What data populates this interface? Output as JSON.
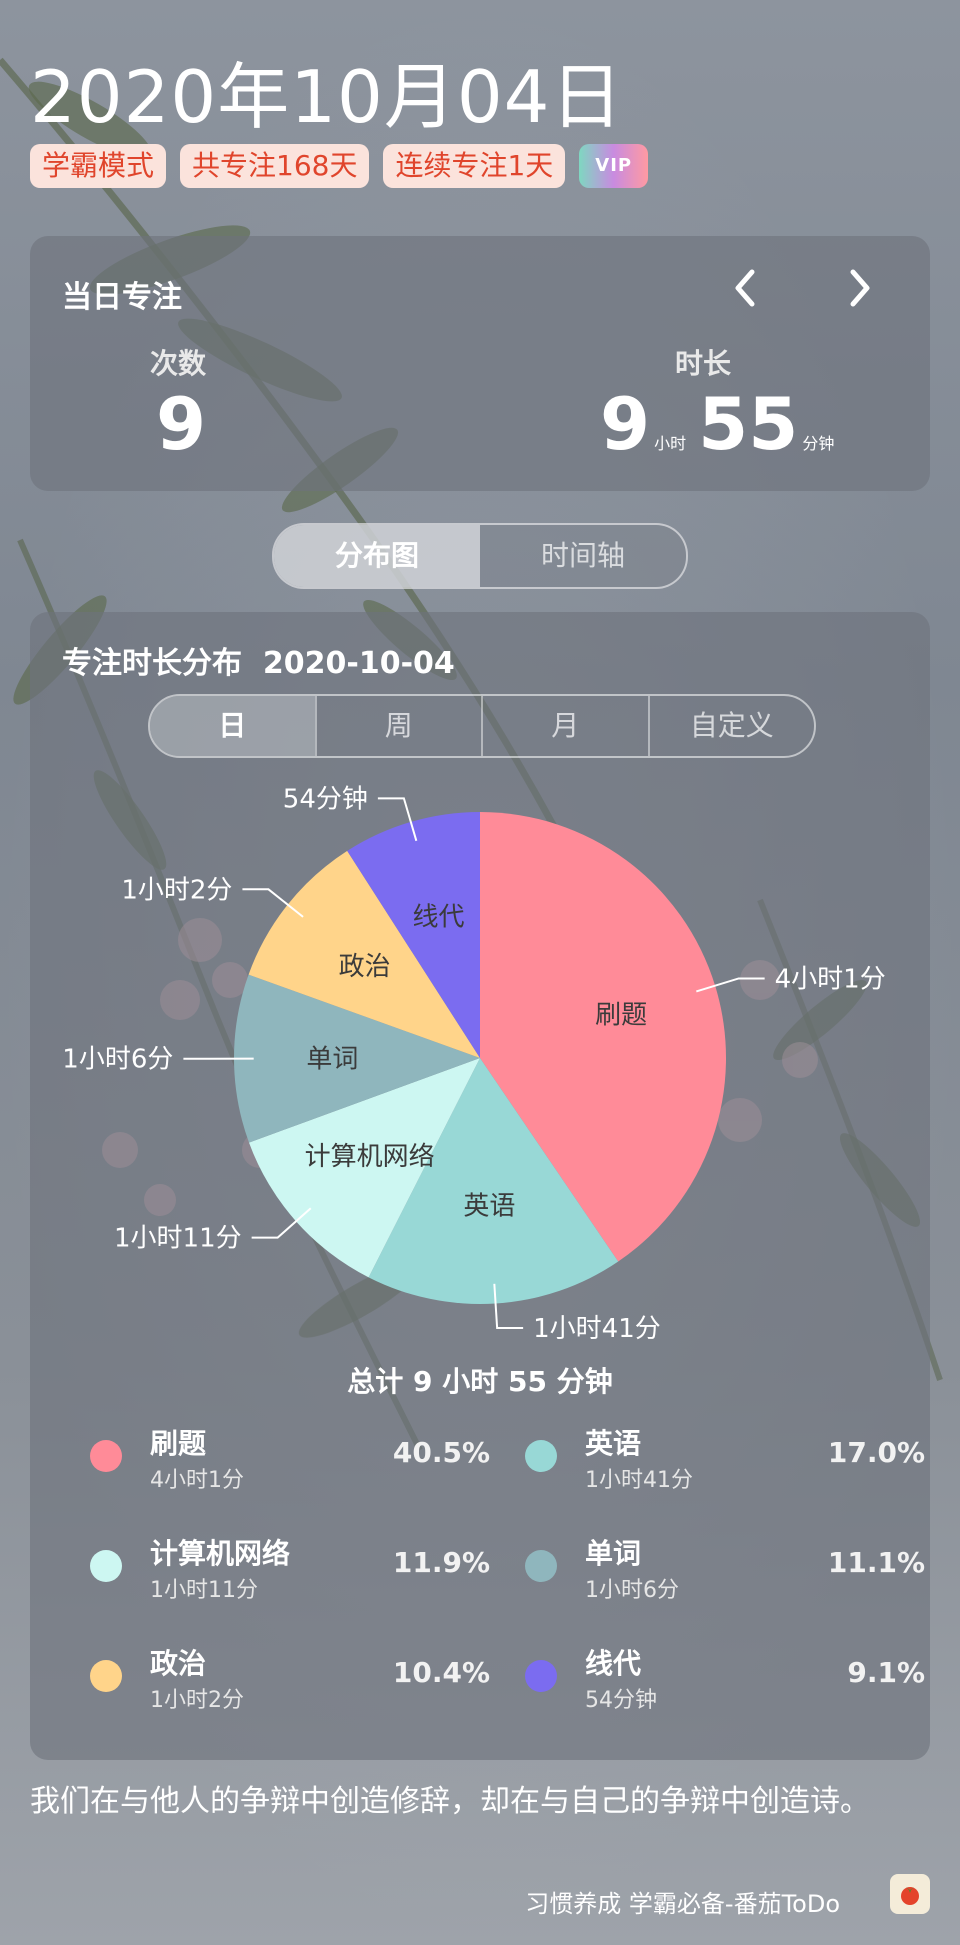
{
  "header": {
    "date": "2020年10月04日",
    "tags": [
      "学霸模式",
      "共专注168天",
      "连续专注1天"
    ],
    "vip": "VIP"
  },
  "daily": {
    "title": "当日专注",
    "count_label": "次数",
    "count": "9",
    "duration_label": "时长",
    "hours": "9",
    "hours_unit": "小时",
    "minutes": "55",
    "minutes_unit": "分钟",
    "prev_icon": "chevron-left-icon",
    "next_icon": "chevron-right-icon"
  },
  "view_toggle": {
    "options": [
      "分布图",
      "时间轴"
    ],
    "selected": "分布图"
  },
  "distribution": {
    "title": "专注时长分布",
    "date": "2020-10-04",
    "periods": [
      "日",
      "周",
      "月",
      "自定义"
    ],
    "selected_period": "日",
    "total": "总计 9 小时 55 分钟"
  },
  "chart_data": {
    "type": "pie",
    "slices": [
      {
        "name": "刷题",
        "value": 241,
        "duration": "4小时1分",
        "percent": "40.5%",
        "color": "#ff8b98"
      },
      {
        "name": "英语",
        "value": 101,
        "duration": "1小时41分",
        "percent": "17.0%",
        "color": "#98d8d6"
      },
      {
        "name": "计算机网络",
        "value": 71,
        "duration": "1小时11分",
        "percent": "11.9%",
        "color": "#cdf7f2"
      },
      {
        "name": "单词",
        "value": 66,
        "duration": "1小时6分",
        "percent": "11.1%",
        "color": "#8fb6bd"
      },
      {
        "name": "政治",
        "value": 62,
        "duration": "1小时2分",
        "percent": "10.4%",
        "color": "#ffd48a"
      },
      {
        "name": "线代",
        "value": 54,
        "duration": "54分钟",
        "percent": "9.1%",
        "color": "#7b6cf0"
      }
    ]
  },
  "quote": "我们在与他人的争辩中创造修辞，却在与自己的争辩中创造诗。",
  "footer": {
    "text": "习惯养成 学霸必备-番茄ToDo",
    "icon": "tomato-icon"
  }
}
